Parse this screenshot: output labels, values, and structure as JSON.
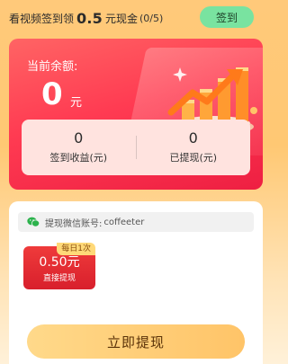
{
  "header": {
    "text_prefix": "看视频签到领",
    "amount": "0.5",
    "text_suffix": "元现金",
    "progress": "(0/5)",
    "signin_label": "签到"
  },
  "balance": {
    "label": "当前余额:",
    "value": "0",
    "unit": "元",
    "stats": [
      {
        "value": "0",
        "label": "签到收益(元)"
      },
      {
        "value": "0",
        "label": "已提现(元)"
      }
    ]
  },
  "withdraw": {
    "wechat_label": "提现微信账号:",
    "wechat_account": "coffeeter",
    "options": [
      {
        "tag": "每日1次",
        "amount": "0.50元",
        "subtitle": "直接提现"
      }
    ],
    "button_label": "立即提现"
  },
  "colors": {
    "card_red": "#ee1f42",
    "signin_green": "#79e3a0",
    "button_gold": "#ffc468"
  }
}
